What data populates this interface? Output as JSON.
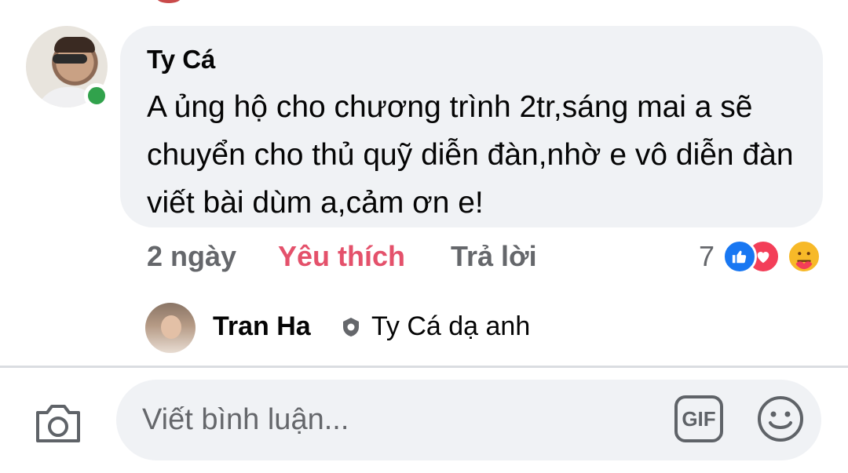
{
  "comment": {
    "author": "Ty Cá",
    "text": "A ủng hộ cho chương trình 2tr,sáng mai a sẽ chuyển cho thủ quỹ diễn đàn,nhờ e vô diễn đàn viết bài dùm a,cảm ơn e!",
    "time": "2 ngày",
    "like_label": "Yêu thích",
    "reply_label": "Trả lời",
    "reaction_count": "7",
    "reactions": [
      "like-icon",
      "love-icon",
      "care-icon"
    ],
    "online": true
  },
  "reply": {
    "author": "Tran Ha",
    "badge_icon": "shield-badge-icon",
    "text": "Ty Cá dạ anh"
  },
  "composer": {
    "placeholder": "Viết bình luận...",
    "gif_label": "GIF",
    "camera_icon": "camera-icon",
    "emoji_icon": "emoji-icon"
  },
  "colors": {
    "bubble_bg": "#f0f2f5",
    "like_active": "#e4516b",
    "secondary_text": "#65676b",
    "online": "#31a24c",
    "like_reaction": "#1877f2",
    "love_reaction": "#f33e58",
    "care_reaction": "#f7b928"
  }
}
